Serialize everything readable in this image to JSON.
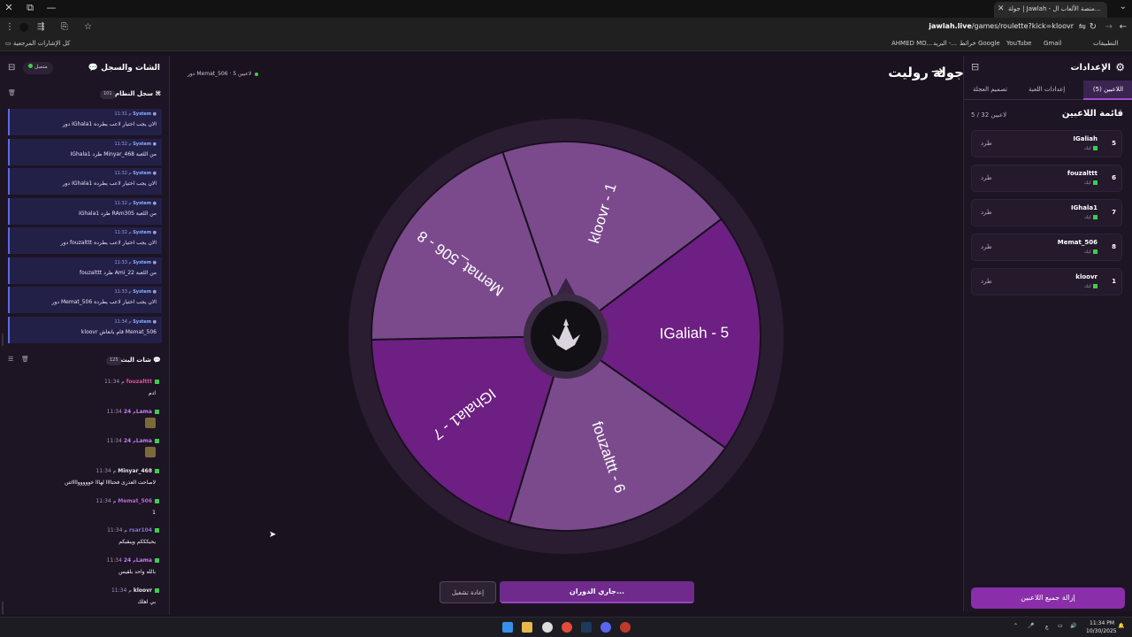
{
  "browser": {
    "tab_title": "جولة | Jawlah - منصة الألعاب ال...",
    "url_domain": "jawlah.live",
    "url_path": "/games/roulette?kick=kloovr",
    "bookmarks_right": [
      "التطبيقات",
      "Gmail",
      "YouTube",
      "خرائط Google",
      "البريد -...",
      "AHMED MO..."
    ],
    "bookmarks_left": "كل الإشارات المرجعية"
  },
  "settings": {
    "title": "الإعدادات",
    "tabs": {
      "players": "اللاعبين (5)",
      "game": "إعدادات اللعبة",
      "wheel": "تصميم العجلة"
    },
    "players_title": "قائمة اللاعبين",
    "players_count": "5 / 32 لاعبين",
    "kick_label": "طرد",
    "source_label": "كيك",
    "players": [
      {
        "num": "5",
        "name": "IGaliah"
      },
      {
        "num": "6",
        "name": "fouzalttt"
      },
      {
        "num": "7",
        "name": "IGhala1"
      },
      {
        "num": "8",
        "name": "Memat_506"
      },
      {
        "num": "1",
        "name": "kloovr"
      }
    ],
    "remove_all": "إزالة جميع اللاعبين"
  },
  "chat": {
    "title": "الشات والسجل",
    "status": "متصل",
    "system_log": {
      "title": "سجل النظام",
      "count": "101"
    },
    "system_items": [
      {
        "time": "11:31 م",
        "author": "System",
        "msg": "دور IGhala1 الان يجب اختيار لاعب يطرده"
      },
      {
        "time": "11:32 م",
        "author": "System",
        "msg": "IGhala1 طرد Minyar_468 من اللعبة"
      },
      {
        "time": "11:32 م",
        "author": "System",
        "msg": "دور IGhala1 الان يجب اختيار لاعب يطرده"
      },
      {
        "time": "11:32 م",
        "author": "System",
        "msg": "IGhala1 طرد RAm305 من اللعبة"
      },
      {
        "time": "11:32 م",
        "author": "System",
        "msg": "دور fouzalttt الان يجب اختيار لاعب يطرده"
      },
      {
        "time": "11:33 م",
        "author": "System",
        "msg": "fouzalttt طرد Ami_22 من اللعبة"
      },
      {
        "time": "11:33 م",
        "author": "System",
        "msg": "دور Memat_506 الان يجب اختيار لاعب يطرده"
      },
      {
        "time": "11:34 م",
        "author": "System",
        "msg": "kloovr قام بانعاش Memat_506"
      }
    ],
    "live_chat": {
      "title": "شات البث",
      "count": "125"
    },
    "messages": [
      {
        "time": "11:34 م",
        "user": "fouzalttt",
        "color": "#e0529c",
        "text": "ادم"
      },
      {
        "time": "11:34 م",
        "user": "24Lama",
        "color": "#c77dff",
        "text": "",
        "emoji": true
      },
      {
        "time": "11:34 م",
        "user": "24Lama",
        "color": "#c77dff",
        "text": "",
        "emoji": true
      },
      {
        "time": "11:34 م",
        "user": "Minyar_468",
        "color": "#e6e6e6",
        "text": "لاصاحت العذرى فحتاااا لهااا خوووووااااتتن"
      },
      {
        "time": "11:34 م",
        "user": "Memat_506",
        "color": "#b36bd6",
        "text": "1"
      },
      {
        "time": "11:34 م",
        "user": "rsar104",
        "color": "#7f77d9",
        "text": "يحيكككم ويبقيكم"
      },
      {
        "time": "11:34 م",
        "user": "24Lama",
        "color": "#c77dff",
        "text": "بالله واحد بلقيس"
      },
      {
        "time": "11:34 م",
        "user": "kloovr",
        "color": "#e6e6e6",
        "text": "بي اهلك"
      }
    ]
  },
  "game": {
    "title": "جولة روليت",
    "players_online": "5 لاعبين",
    "turn_label": "دور Memat_506",
    "spinning_label": "جاري الدوران...",
    "restart_label": "إعادة تشغيل"
  },
  "wheel": {
    "colors": [
      "#7b4a8c",
      "#6e1f83"
    ],
    "segments": [
      "kloovr - 1",
      "IGaliah - 5",
      "fouzalttt - 6",
      "IGhala1 - 7",
      "Memat_506 - 8"
    ],
    "rotation_deg": -19
  },
  "taskbar": {
    "lang": "ع",
    "time": "11:34 PM",
    "date": "10/30/2025"
  }
}
